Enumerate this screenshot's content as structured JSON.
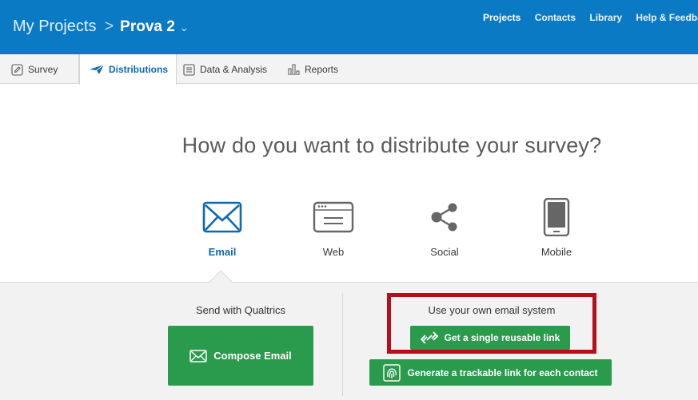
{
  "header": {
    "breadcrumb_root": "My Projects",
    "breadcrumb_sep": ">",
    "project_name": "Prova 2",
    "nav": [
      "Projects",
      "Contacts",
      "Library",
      "Help & Feedba"
    ]
  },
  "tabs": [
    "Survey",
    "Distributions",
    "Data & Analysis",
    "Reports"
  ],
  "main": {
    "heading": "How do you want to distribute your survey?",
    "methods": [
      "Email",
      "Web",
      "Social",
      "Mobile"
    ]
  },
  "panel": {
    "left_title": "Send with Qualtrics",
    "compose_label": "Compose Email",
    "right_title": "Use your own email system",
    "reusable_link_label": "Get a single reusable link",
    "trackable_link_label": "Generate a trackable link for each contact"
  },
  "colors": {
    "header": "#0b7ac5",
    "accent_green": "#2a9a4d",
    "highlight_red": "#b80e1b",
    "active_blue": "#0b6ab0"
  }
}
